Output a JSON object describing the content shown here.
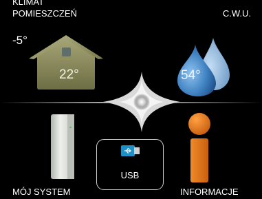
{
  "menu": {
    "climate": {
      "label_line1": "KLIMAT",
      "label_line2": "POMIESZCZEŃ",
      "outdoor_temp": "-5°",
      "room_temp": "22°"
    },
    "hot_water": {
      "label": "C.W.U.",
      "temp": "54°"
    },
    "system": {
      "label": "MÓJ SYSTEM"
    },
    "usb": {
      "label": "USB"
    },
    "info": {
      "label": "INFORMACJE"
    }
  },
  "colors": {
    "background": "#000000",
    "house": "#8f8f5c",
    "water": "#4f8fca",
    "info": "#e8761a",
    "unit": "#d7dcd6"
  }
}
